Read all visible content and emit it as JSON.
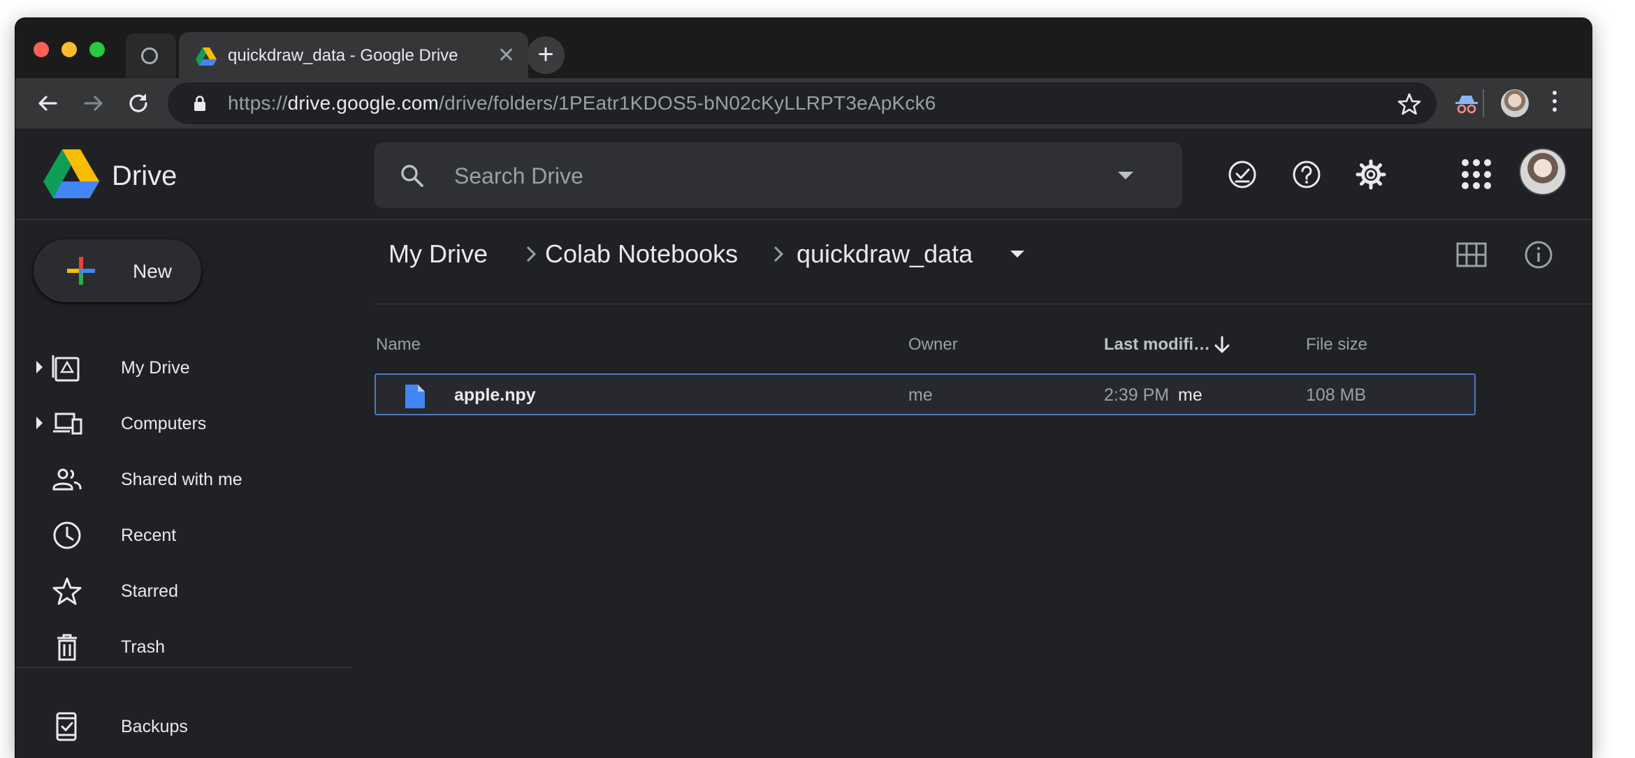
{
  "browser": {
    "active_tab_title": "quickdraw_data - Google Drive",
    "new_tab_label": "+",
    "close_label": "✕",
    "url_scheme": "https://",
    "url_host": "drive.google.com",
    "url_path": "/drive/folders/1PEatr1KDOS5-bN02cKyLLRPT3eApKck6"
  },
  "header": {
    "app_name": "Drive",
    "search_placeholder": "Search Drive"
  },
  "sidebar": {
    "new_label": "New",
    "items": [
      {
        "label": "My Drive",
        "icon": "my-drive-icon",
        "expandable": true
      },
      {
        "label": "Computers",
        "icon": "computers-icon",
        "expandable": true
      },
      {
        "label": "Shared with me",
        "icon": "people-icon",
        "expandable": false
      },
      {
        "label": "Recent",
        "icon": "clock-icon",
        "expandable": false
      },
      {
        "label": "Starred",
        "icon": "star-icon",
        "expandable": false
      },
      {
        "label": "Trash",
        "icon": "trash-icon",
        "expandable": false
      },
      {
        "label": "Backups",
        "icon": "backups-icon",
        "expandable": false
      }
    ]
  },
  "breadcrumb": [
    "My Drive",
    "Colab Notebooks",
    "quickdraw_data"
  ],
  "table": {
    "columns": {
      "name": "Name",
      "owner": "Owner",
      "modified": "Last modifi…",
      "size": "File size"
    },
    "rows": [
      {
        "name": "apple.npy",
        "owner": "me",
        "modified": "2:39 PM",
        "modified_by": "me",
        "size": "108 MB",
        "icon": "file-icon"
      }
    ]
  },
  "colors": {
    "background": "#202124",
    "selection_border": "#4a78c2",
    "file_icon": "#4285f4"
  }
}
